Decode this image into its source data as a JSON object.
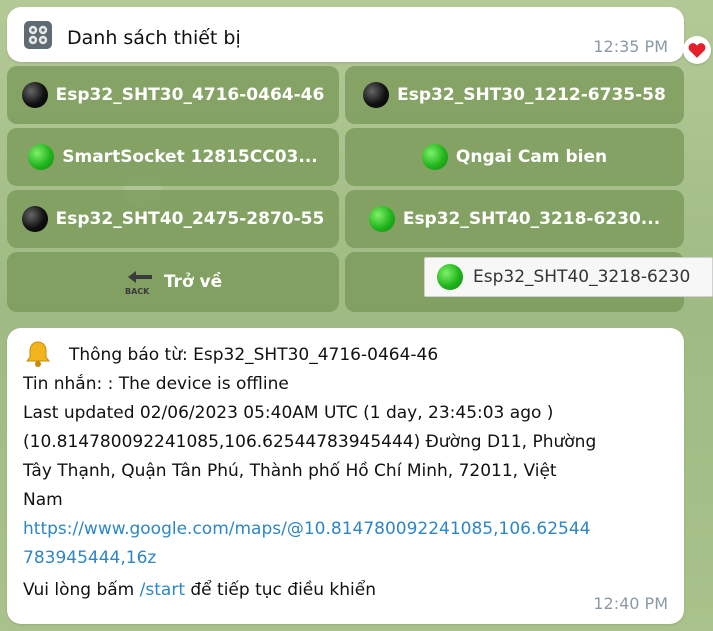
{
  "device_list_message": {
    "title": "Danh sách thiết bị",
    "time": "12:35 PM",
    "reaction": "heart-icon"
  },
  "keyboard": {
    "buttons": [
      {
        "label": "Esp32_SHT30_4716-0464-46",
        "status": "black"
      },
      {
        "label": "Esp32_SHT30_1212-6735-58",
        "status": "black"
      },
      {
        "label": "SmartSocket 12815CC03...",
        "status": "green"
      },
      {
        "label": "Qngai Cam bien",
        "status": "green"
      },
      {
        "label": "Esp32_SHT40_2475-2870-55",
        "status": "black"
      },
      {
        "label": "Esp32_SHT40_3218-6230...",
        "status": "green"
      },
      {
        "label": "Trở về",
        "status": "back"
      }
    ],
    "tooltip": "Esp32_SHT40_3218-6230"
  },
  "notification_message": {
    "header": "Thông báo từ: Esp32_SHT30_4716-0464-46",
    "message": "Tin nhắn:  : The device is offline",
    "last_updated": " Last updated  02/06/2023 05:40AM UTC (1 day, 23:45:03 ago )",
    "address_line1": "  (10.81478009224108​5,106.62544783945444) Đường D11, Phường",
    "address_line2": "Tây Thạnh, Quận Tân Phú, Thành phố Hồ Chí Minh, 72011, Việt",
    "address_line3": "Nam",
    "link_line1": "https://www.google.com/maps/@10.814780092241085,106.62544",
    "link_line2": "783945444,16z",
    "footer_prefix": "Vui lòng  bấm ",
    "footer_command": "/start",
    "footer_suffix": " để tiếp tục điều khiển",
    "time": "12:40 PM"
  },
  "colors": {
    "accent_link": "#2d86c9",
    "keyboard_button": "#76965a",
    "status_green": "#21b51c",
    "status_offline": "#111111",
    "heart": "#e5202b"
  }
}
